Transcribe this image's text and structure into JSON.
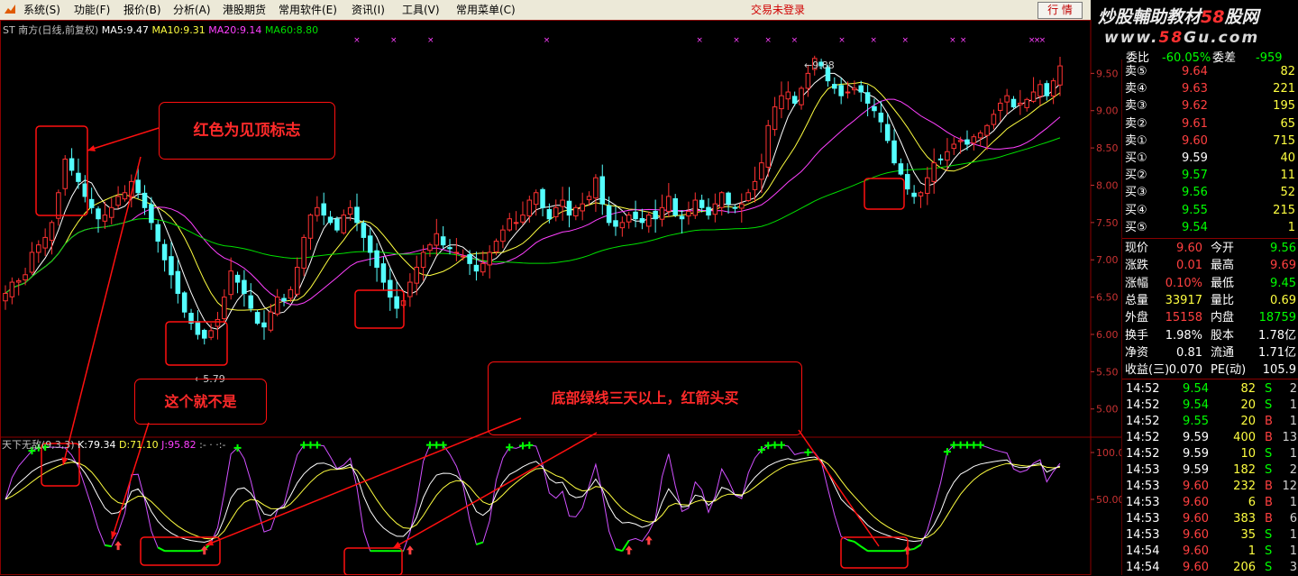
{
  "menu": {
    "items": [
      "系统(S)",
      "功能(F)",
      "报价(B)",
      "分析(A)",
      "港股期货",
      "常用软件(E)",
      "资讯(I)",
      "工具(V)",
      "常用菜单(C)"
    ],
    "login_status": "交易未登录",
    "quote_button": "行 情"
  },
  "banner": {
    "line1_a": "炒股輔助教材",
    "line1_b": "58",
    "line1_c": "股网",
    "line2_a": "www.",
    "line2_b": "58",
    "line2_c": "Gu.com"
  },
  "legend": {
    "title": "ST 南方(日线,前复权)",
    "ma5": "MA5:9.47",
    "ma10": "MA10:9.31",
    "ma20": "MA20:9.14",
    "ma60": "MA60:8.80",
    "indicator_name": "天下无敌(9,3,3)",
    "k": "K:79.34",
    "d": "D:71.10",
    "j": "J:95.82",
    "tail": ":-  ·  ·:-"
  },
  "colors": {
    "up_candle": "#ff3232",
    "down_candle": "#54ffff",
    "ma5": "#ffffff",
    "ma10": "#ffff40",
    "ma20": "#ff40ff",
    "ma60": "#00e000",
    "grid": "#8b0000",
    "annotation": "#ff1010",
    "price_red": "#ff4040",
    "price_green": "#00ff00"
  },
  "chart_data": {
    "type": "candlestick",
    "price_axis_ticks": [
      "9.50",
      "9.00",
      "8.50",
      "8.00",
      "7.50",
      "7.00",
      "6.50",
      "6.00",
      "5.50",
      "5.00"
    ],
    "indicator_axis_ticks": [
      "100.0",
      "50.00"
    ],
    "annotation_high": "9.88",
    "annotation_low": "5.79",
    "price_range": [
      4.9,
      10.0
    ],
    "closes": [
      6.55,
      6.7,
      6.72,
      6.8,
      7.1,
      7.2,
      7.3,
      7.5,
      7.9,
      8.35,
      8.2,
      8.05,
      7.85,
      7.7,
      7.55,
      7.6,
      7.7,
      7.85,
      7.9,
      8.05,
      7.9,
      7.7,
      7.5,
      7.25,
      7.0,
      6.8,
      6.55,
      6.3,
      6.15,
      6.0,
      5.95,
      6.05,
      6.2,
      6.5,
      6.85,
      6.7,
      6.55,
      6.35,
      6.15,
      6.1,
      6.3,
      6.5,
      6.45,
      6.6,
      6.9,
      7.3,
      7.6,
      7.7,
      7.6,
      7.5,
      7.4,
      7.6,
      7.7,
      7.5,
      7.3,
      7.1,
      6.9,
      6.7,
      6.5,
      6.35,
      6.45,
      6.7,
      6.9,
      7.1,
      7.2,
      7.35,
      7.2,
      7.15,
      7.1,
      7.05,
      6.95,
      6.85,
      6.95,
      7.1,
      7.25,
      7.4,
      7.55,
      7.5,
      7.6,
      7.8,
      7.9,
      7.7,
      7.55,
      7.7,
      7.8,
      7.6,
      7.7,
      7.75,
      7.85,
      8.1,
      7.75,
      7.5,
      7.45,
      7.5,
      7.6,
      7.55,
      7.5,
      7.6,
      7.55,
      7.7,
      7.85,
      7.6,
      7.55,
      7.65,
      7.8,
      7.7,
      7.6,
      7.75,
      7.9,
      7.75,
      7.7,
      7.75,
      7.9,
      8.05,
      8.3,
      8.8,
      9.05,
      9.2,
      9.25,
      9.1,
      9.3,
      9.5,
      9.7,
      9.6,
      9.4,
      9.3,
      9.2,
      9.25,
      9.3,
      9.25,
      9.1,
      9.0,
      8.85,
      8.6,
      8.3,
      8.15,
      7.95,
      7.85,
      7.9,
      8.1,
      8.3,
      8.35,
      8.45,
      8.55,
      8.6,
      8.55,
      8.65,
      8.7,
      8.8,
      8.95,
      9.1,
      9.2,
      9.05,
      9.1,
      9.15,
      9.25,
      9.35,
      9.2,
      9.4,
      9.6
    ],
    "ma_series": [
      "MA5",
      "MA10",
      "MA20",
      "MA60"
    ],
    "kdj_series": [
      "K",
      "D",
      "J"
    ]
  },
  "annotations": {
    "red_top": "红色为见顶标志",
    "not_this": "这个就不是",
    "green_buy": "底部绿线三天以上，红箭头买"
  },
  "order_book": [
    {
      "label": "卖⑤",
      "price": "9.64",
      "vol": "82",
      "pc": "red"
    },
    {
      "label": "卖④",
      "price": "9.63",
      "vol": "221",
      "pc": "red"
    },
    {
      "label": "卖③",
      "price": "9.62",
      "vol": "195",
      "pc": "red"
    },
    {
      "label": "卖②",
      "price": "9.61",
      "vol": "65",
      "pc": "red"
    },
    {
      "label": "卖①",
      "price": "9.60",
      "vol": "715",
      "pc": "red"
    },
    {
      "label": "买①",
      "price": "9.59",
      "vol": "40",
      "pc": "white"
    },
    {
      "label": "买②",
      "price": "9.57",
      "vol": "11",
      "pc": "green"
    },
    {
      "label": "买③",
      "price": "9.56",
      "vol": "52",
      "pc": "green"
    },
    {
      "label": "买④",
      "price": "9.55",
      "vol": "215",
      "pc": "green"
    },
    {
      "label": "买⑤",
      "price": "9.54",
      "vol": "1",
      "pc": "green"
    }
  ],
  "partial_top_row": {
    "l1": "委比",
    "v1": "-60.05%",
    "l2": "委差",
    "v2": "-959"
  },
  "stats": [
    {
      "l1": "现价",
      "v1": "9.60",
      "c1": "red",
      "l2": "今开",
      "v2": "9.56",
      "c2": "green"
    },
    {
      "l1": "涨跌",
      "v1": "0.01",
      "c1": "red",
      "l2": "最高",
      "v2": "9.69",
      "c2": "red"
    },
    {
      "l1": "涨幅",
      "v1": "0.10%",
      "c1": "red",
      "l2": "最低",
      "v2": "9.45",
      "c2": "green"
    },
    {
      "l1": "总量",
      "v1": "33917",
      "c1": "yellow",
      "l2": "量比",
      "v2": "0.69",
      "c2": "yellow"
    },
    {
      "l1": "外盘",
      "v1": "15158",
      "c1": "red",
      "l2": "内盘",
      "v2": "18759",
      "c2": "green"
    },
    {
      "l1": "换手",
      "v1": "1.98%",
      "c1": "white",
      "l2": "股本",
      "v2": "1.78亿",
      "c2": "white"
    },
    {
      "l1": "净资",
      "v1": "0.81",
      "c1": "white",
      "l2": "流通",
      "v2": "1.71亿",
      "c2": "white"
    },
    {
      "l1": "收益(三)",
      "v1": "0.070",
      "c1": "white",
      "l2": "PE(动)",
      "v2": "105.9",
      "c2": "white"
    }
  ],
  "ticks": [
    {
      "time": "14:52",
      "price": "9.54",
      "pc": "green",
      "vol": "82",
      "side": "S",
      "n": "2"
    },
    {
      "time": "14:52",
      "price": "9.54",
      "pc": "green",
      "vol": "20",
      "side": "S",
      "n": "1"
    },
    {
      "time": "14:52",
      "price": "9.55",
      "pc": "green",
      "vol": "20",
      "side": "B",
      "n": "1"
    },
    {
      "time": "14:52",
      "price": "9.59",
      "pc": "white",
      "vol": "400",
      "side": "B",
      "n": "13"
    },
    {
      "time": "14:52",
      "price": "9.59",
      "pc": "white",
      "vol": "10",
      "side": "S",
      "n": "1"
    },
    {
      "time": "14:53",
      "price": "9.59",
      "pc": "white",
      "vol": "182",
      "side": "S",
      "n": "2"
    },
    {
      "time": "14:53",
      "price": "9.60",
      "pc": "red",
      "vol": "232",
      "side": "B",
      "n": "12"
    },
    {
      "time": "14:53",
      "price": "9.60",
      "pc": "red",
      "vol": "6",
      "side": "B",
      "n": "1"
    },
    {
      "time": "14:53",
      "price": "9.60",
      "pc": "red",
      "vol": "383",
      "side": "B",
      "n": "6"
    },
    {
      "time": "14:53",
      "price": "9.60",
      "pc": "red",
      "vol": "35",
      "side": "S",
      "n": "1"
    },
    {
      "time": "14:54",
      "price": "9.60",
      "pc": "red",
      "vol": "1",
      "side": "S",
      "n": "1"
    },
    {
      "time": "14:54",
      "price": "9.60",
      "pc": "red",
      "vol": "206",
      "side": "S",
      "n": "3"
    }
  ]
}
